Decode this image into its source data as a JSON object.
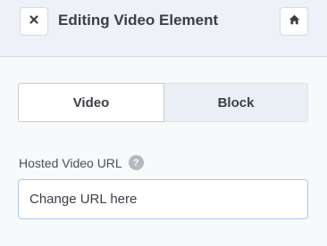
{
  "header": {
    "title": "Editing Video Element",
    "close_icon": "close-icon",
    "home_icon": "home-icon"
  },
  "tabs": [
    {
      "label": "Video",
      "active": true
    },
    {
      "label": "Block",
      "active": false
    }
  ],
  "field": {
    "label": "Hosted Video URL",
    "help_icon": "?",
    "value": "",
    "placeholder": "Change URL here"
  },
  "colors": {
    "header_bg": "#eef1f7",
    "text": "#3b4046",
    "input_border_focus": "#a9c7f1"
  }
}
